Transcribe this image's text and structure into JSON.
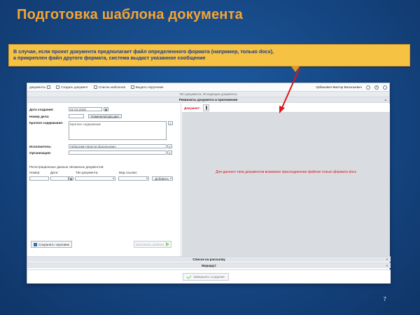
{
  "slide": {
    "title": "Подготовка шаблона документа",
    "callout_line1": "В случае, если проект документа предполагает файл определенного формата (например, только docx),",
    "callout_line2": "а прикреплен файл другого формата, система выдаст указанное сообщение",
    "page_number": "7"
  },
  "toolbar": {
    "documents": "документы",
    "create": "Создать документ",
    "templates": "Список шаблонов",
    "order": "Выдать поручение",
    "user": "Урбанович Виктор Васильевич",
    "help_icon": "?"
  },
  "bars": {
    "doc_type": "Тип документа: Исходящие документы",
    "requisites": "Реквизиты документа и приложения",
    "mailing": "Список на рассылку",
    "route": "Маршрут"
  },
  "form": {
    "date_label": "Дата создания:",
    "date_value": "02.03.2020",
    "number_label": "Номер дела:",
    "nomenclature_btn": "Номенклатура дел",
    "summary_label": "Краткое содержание:",
    "summary_value": "Краткое содержание",
    "executor_label": "Исполнитель:",
    "executor_value": "Урбанович Виктор Васильевич",
    "org_label": "Организация:",
    "reg_title": "Регистрационные данные связанных документов:",
    "col_number": "Номер:",
    "col_date": "Дата:",
    "col_type": "Тип документа:",
    "col_link": "Вид ссылки:",
    "add_btn": "Добавить",
    "save_draft": "Сохранить черновик",
    "fill_template": "Заполнить шаблон",
    "finish": "Завершить создание"
  },
  "doc_panel": {
    "doc_label": "Документ:",
    "message": "Для данного типа документов возможно присоединение файлов только формата docx"
  },
  "colors": {
    "title": "#f6a531",
    "callout_bg": "#f5c244",
    "callout_text": "#1d3a8a",
    "error": "#e0161b",
    "arrow": "#e0161b"
  }
}
